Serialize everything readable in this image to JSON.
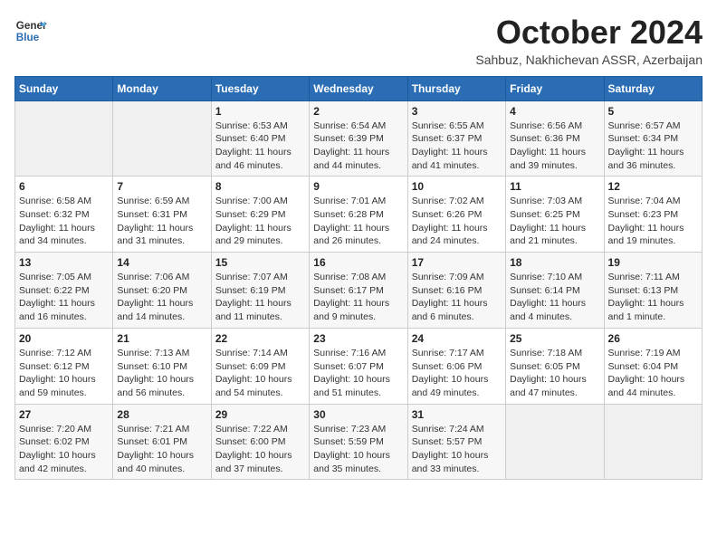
{
  "logo": {
    "line1": "General",
    "line2": "Blue"
  },
  "title": "October 2024",
  "subtitle": "Sahbuz, Nakhichevan ASSR, Azerbaijan",
  "headers": [
    "Sunday",
    "Monday",
    "Tuesday",
    "Wednesday",
    "Thursday",
    "Friday",
    "Saturday"
  ],
  "weeks": [
    [
      {
        "day": "",
        "info": ""
      },
      {
        "day": "",
        "info": ""
      },
      {
        "day": "1",
        "info": "Sunrise: 6:53 AM\nSunset: 6:40 PM\nDaylight: 11 hours and 46 minutes."
      },
      {
        "day": "2",
        "info": "Sunrise: 6:54 AM\nSunset: 6:39 PM\nDaylight: 11 hours and 44 minutes."
      },
      {
        "day": "3",
        "info": "Sunrise: 6:55 AM\nSunset: 6:37 PM\nDaylight: 11 hours and 41 minutes."
      },
      {
        "day": "4",
        "info": "Sunrise: 6:56 AM\nSunset: 6:36 PM\nDaylight: 11 hours and 39 minutes."
      },
      {
        "day": "5",
        "info": "Sunrise: 6:57 AM\nSunset: 6:34 PM\nDaylight: 11 hours and 36 minutes."
      }
    ],
    [
      {
        "day": "6",
        "info": "Sunrise: 6:58 AM\nSunset: 6:32 PM\nDaylight: 11 hours and 34 minutes."
      },
      {
        "day": "7",
        "info": "Sunrise: 6:59 AM\nSunset: 6:31 PM\nDaylight: 11 hours and 31 minutes."
      },
      {
        "day": "8",
        "info": "Sunrise: 7:00 AM\nSunset: 6:29 PM\nDaylight: 11 hours and 29 minutes."
      },
      {
        "day": "9",
        "info": "Sunrise: 7:01 AM\nSunset: 6:28 PM\nDaylight: 11 hours and 26 minutes."
      },
      {
        "day": "10",
        "info": "Sunrise: 7:02 AM\nSunset: 6:26 PM\nDaylight: 11 hours and 24 minutes."
      },
      {
        "day": "11",
        "info": "Sunrise: 7:03 AM\nSunset: 6:25 PM\nDaylight: 11 hours and 21 minutes."
      },
      {
        "day": "12",
        "info": "Sunrise: 7:04 AM\nSunset: 6:23 PM\nDaylight: 11 hours and 19 minutes."
      }
    ],
    [
      {
        "day": "13",
        "info": "Sunrise: 7:05 AM\nSunset: 6:22 PM\nDaylight: 11 hours and 16 minutes."
      },
      {
        "day": "14",
        "info": "Sunrise: 7:06 AM\nSunset: 6:20 PM\nDaylight: 11 hours and 14 minutes."
      },
      {
        "day": "15",
        "info": "Sunrise: 7:07 AM\nSunset: 6:19 PM\nDaylight: 11 hours and 11 minutes."
      },
      {
        "day": "16",
        "info": "Sunrise: 7:08 AM\nSunset: 6:17 PM\nDaylight: 11 hours and 9 minutes."
      },
      {
        "day": "17",
        "info": "Sunrise: 7:09 AM\nSunset: 6:16 PM\nDaylight: 11 hours and 6 minutes."
      },
      {
        "day": "18",
        "info": "Sunrise: 7:10 AM\nSunset: 6:14 PM\nDaylight: 11 hours and 4 minutes."
      },
      {
        "day": "19",
        "info": "Sunrise: 7:11 AM\nSunset: 6:13 PM\nDaylight: 11 hours and 1 minute."
      }
    ],
    [
      {
        "day": "20",
        "info": "Sunrise: 7:12 AM\nSunset: 6:12 PM\nDaylight: 10 hours and 59 minutes."
      },
      {
        "day": "21",
        "info": "Sunrise: 7:13 AM\nSunset: 6:10 PM\nDaylight: 10 hours and 56 minutes."
      },
      {
        "day": "22",
        "info": "Sunrise: 7:14 AM\nSunset: 6:09 PM\nDaylight: 10 hours and 54 minutes."
      },
      {
        "day": "23",
        "info": "Sunrise: 7:16 AM\nSunset: 6:07 PM\nDaylight: 10 hours and 51 minutes."
      },
      {
        "day": "24",
        "info": "Sunrise: 7:17 AM\nSunset: 6:06 PM\nDaylight: 10 hours and 49 minutes."
      },
      {
        "day": "25",
        "info": "Sunrise: 7:18 AM\nSunset: 6:05 PM\nDaylight: 10 hours and 47 minutes."
      },
      {
        "day": "26",
        "info": "Sunrise: 7:19 AM\nSunset: 6:04 PM\nDaylight: 10 hours and 44 minutes."
      }
    ],
    [
      {
        "day": "27",
        "info": "Sunrise: 7:20 AM\nSunset: 6:02 PM\nDaylight: 10 hours and 42 minutes."
      },
      {
        "day": "28",
        "info": "Sunrise: 7:21 AM\nSunset: 6:01 PM\nDaylight: 10 hours and 40 minutes."
      },
      {
        "day": "29",
        "info": "Sunrise: 7:22 AM\nSunset: 6:00 PM\nDaylight: 10 hours and 37 minutes."
      },
      {
        "day": "30",
        "info": "Sunrise: 7:23 AM\nSunset: 5:59 PM\nDaylight: 10 hours and 35 minutes."
      },
      {
        "day": "31",
        "info": "Sunrise: 7:24 AM\nSunset: 5:57 PM\nDaylight: 10 hours and 33 minutes."
      },
      {
        "day": "",
        "info": ""
      },
      {
        "day": "",
        "info": ""
      }
    ]
  ]
}
